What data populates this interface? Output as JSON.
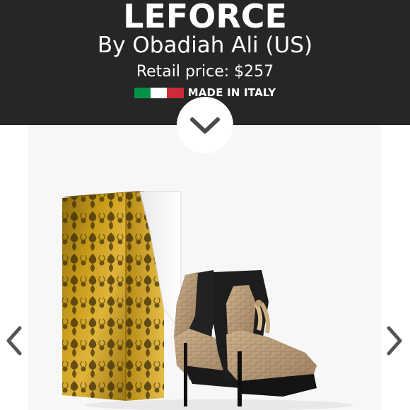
{
  "product": {
    "title": "LEFORCE",
    "byline": "By Obadiah Ali (US)",
    "price": "Retail price: $257",
    "made_in": "MADE IN ITALY"
  },
  "flag_colors": [
    "#009246",
    "#ffffff",
    "#ce2b37"
  ],
  "colors": {
    "header_bg": "#262626",
    "box_gold": "#b88d12",
    "leather_tan": "#b89a73",
    "shoe_black": "#1e1e1e"
  },
  "icons": {
    "scroll_down": "chevron-down-icon",
    "previous": "chevron-left-icon",
    "next": "chevron-right-icon"
  }
}
